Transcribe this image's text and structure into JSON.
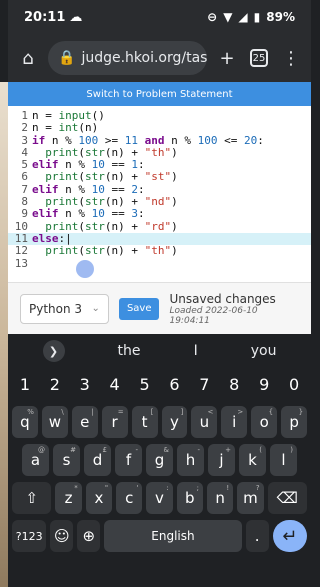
{
  "status": {
    "time": "20:11",
    "battery": "89%"
  },
  "browser": {
    "url": "judge.hkoi.org/task/D",
    "tab_count": "25"
  },
  "page": {
    "switch_label": "Switch to Problem Statement",
    "language": "Python 3",
    "save_label": "Save",
    "unsaved_title": "Unsaved changes",
    "loaded_text": "Loaded 2022-06-10 19:04:11"
  },
  "code": {
    "lines": [
      {
        "n": "1",
        "text": "n = input()"
      },
      {
        "n": "2",
        "text": "n = int(n)"
      },
      {
        "n": "3",
        "text": "if n % 100 >= 11 and n % 100 <= 20:"
      },
      {
        "n": "4",
        "text": "  print(str(n) + \"th\")"
      },
      {
        "n": "5",
        "text": "elif n % 10 == 1:"
      },
      {
        "n": "6",
        "text": "  print(str(n) + \"st\")"
      },
      {
        "n": "7",
        "text": "elif n % 10 == 2:"
      },
      {
        "n": "8",
        "text": "  print(str(n) + \"nd\")"
      },
      {
        "n": "9",
        "text": "elif n % 10 == 3:"
      },
      {
        "n": "10",
        "text": "  print(str(n) + \"rd\")"
      },
      {
        "n": "11",
        "text": "else:"
      },
      {
        "n": "12",
        "text": "  print(str(n) + \"th\")"
      },
      {
        "n": "13",
        "text": ""
      }
    ]
  },
  "keyboard": {
    "suggestions": [
      "the",
      "I",
      "you"
    ],
    "numbers": [
      "1",
      "2",
      "3",
      "4",
      "5",
      "6",
      "7",
      "8",
      "9",
      "0"
    ],
    "row1": [
      [
        "q",
        "%"
      ],
      [
        "w",
        "\\"
      ],
      [
        "e",
        "|"
      ],
      [
        "r",
        "="
      ],
      [
        "t",
        "["
      ],
      [
        "y",
        "]"
      ],
      [
        "u",
        "<"
      ],
      [
        "i",
        ">"
      ],
      [
        "o",
        "{"
      ],
      [
        "p",
        "}"
      ]
    ],
    "row2": [
      [
        "a",
        "@"
      ],
      [
        "s",
        "#"
      ],
      [
        "d",
        "£"
      ],
      [
        "f",
        "-"
      ],
      [
        "g",
        "&"
      ],
      [
        "h",
        "-"
      ],
      [
        "j",
        "+"
      ],
      [
        "k",
        "("
      ],
      [
        "l",
        ")"
      ]
    ],
    "row3": [
      [
        "z",
        "*"
      ],
      [
        "x",
        "\""
      ],
      [
        "c",
        "'"
      ],
      [
        "v",
        ":"
      ],
      [
        "b",
        ";"
      ],
      [
        "n",
        "!"
      ],
      [
        "m",
        "?"
      ]
    ],
    "symbols_key": "?123",
    "space_label": "English"
  }
}
